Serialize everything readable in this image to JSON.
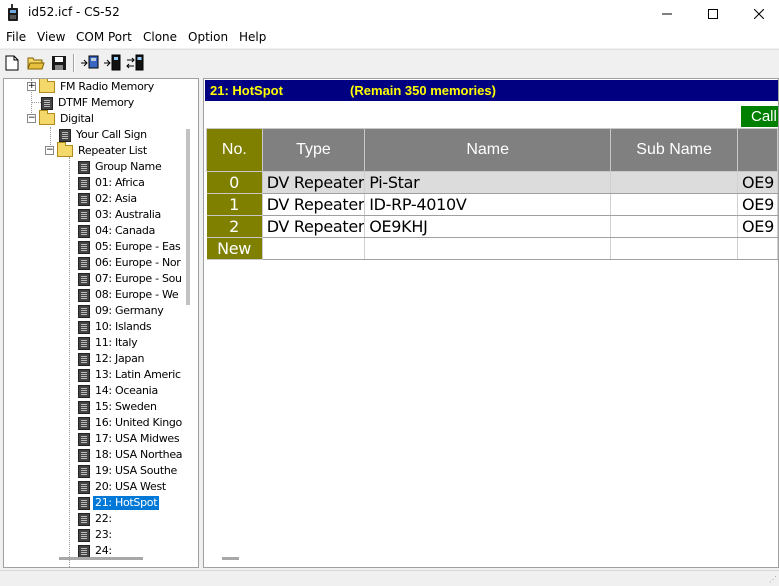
{
  "window": {
    "title": "id52.icf - CS-52"
  },
  "menu": [
    "File",
    "View",
    "COM Port",
    "Clone",
    "Option",
    "Help"
  ],
  "toolbar": {
    "icons": [
      "new-file-icon",
      "open-folder-icon",
      "save-icon",
      "read-from-radio-icon",
      "write-to-radio-icon",
      "clone-icon"
    ]
  },
  "tree": {
    "fm_radio_memory": "FM Radio Memory",
    "dtmf_memory": "DTMF Memory",
    "digital": "Digital",
    "your_call_sign": "Your Call Sign",
    "repeater_list": "Repeater List",
    "group_name": "Group Name",
    "groups": [
      "01: Africa",
      "02: Asia",
      "03: Australia",
      "04: Canada",
      "05: Europe - Eas",
      "06: Europe - Nor",
      "07: Europe - Sou",
      "08: Europe - We",
      "09: Germany",
      "10: Islands",
      "11: Italy",
      "12: Japan",
      "13: Latin Americ",
      "14: Oceania",
      "15: Sweden",
      "16: United Kingo",
      "17: USA Midwes",
      "18: USA Northea",
      "19: USA Southe",
      "20: USA West",
      "21: HotSpot",
      "22:",
      "23:",
      "24:"
    ],
    "selected_index": 20
  },
  "main": {
    "group_title": "21: HotSpot",
    "remain": "(Remain 350 memories)",
    "call_button": "Call",
    "columns": [
      "No.",
      "Type",
      "Name",
      "Sub Name",
      ""
    ],
    "rows": [
      {
        "no": "0",
        "type": "DV Repeater",
        "name": "Pi-Star",
        "sub": "",
        "call": "OE9"
      },
      {
        "no": "1",
        "type": "DV Repeater",
        "name": "ID-RP-4010V",
        "sub": "",
        "call": "OE9"
      },
      {
        "no": "2",
        "type": "DV Repeater",
        "name": "OE9KHJ",
        "sub": "",
        "call": "OE9"
      },
      {
        "no": "New",
        "type": "",
        "name": "",
        "sub": "",
        "call": ""
      }
    ]
  }
}
